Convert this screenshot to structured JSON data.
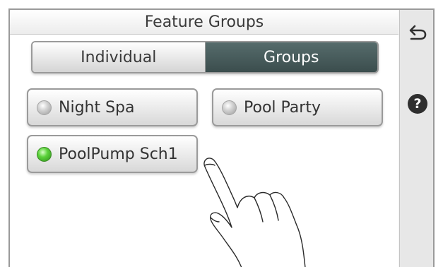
{
  "title": "Feature Groups",
  "tabs": [
    {
      "label": "Individual",
      "selected": false
    },
    {
      "label": "Groups",
      "selected": true
    }
  ],
  "groups": [
    {
      "label": "Night Spa",
      "active": false
    },
    {
      "label": "Pool Party",
      "active": false
    },
    {
      "label": "PoolPump Sch1",
      "active": true
    }
  ],
  "sidebar": {
    "back_icon": "back-arrow-icon",
    "help_icon": "help-icon",
    "help_glyph": "?"
  },
  "colors": {
    "active_led": "#5bd23a",
    "selected_tab": "#4a5e5e"
  }
}
